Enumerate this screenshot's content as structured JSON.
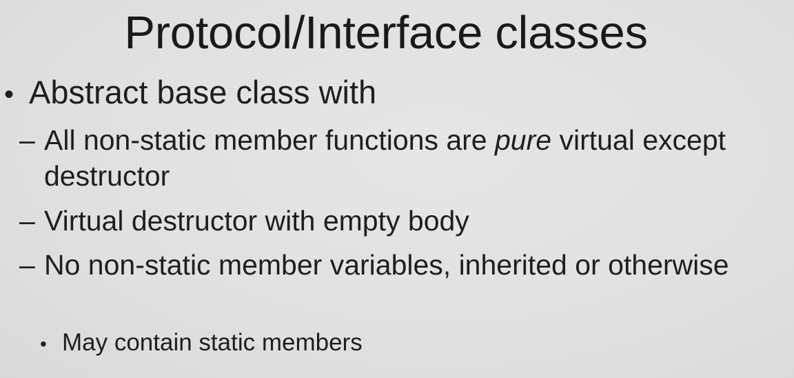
{
  "slide": {
    "title": "Protocol/Interface classes",
    "bullet": {
      "marker": "•",
      "text": "Abstract base class with"
    },
    "sub_bullets": [
      {
        "marker": "–",
        "text_before": "All non-static member functions are ",
        "emphasis": "pure",
        "text_after": " virtual except destructor"
      },
      {
        "marker": "–",
        "text": "Virtual destructor with empty body"
      },
      {
        "marker": "–",
        "text": "No non-static member variables, inherited or otherwise"
      }
    ],
    "sub_sub_bullet": {
      "marker": "•",
      "text": "May contain static members"
    }
  }
}
